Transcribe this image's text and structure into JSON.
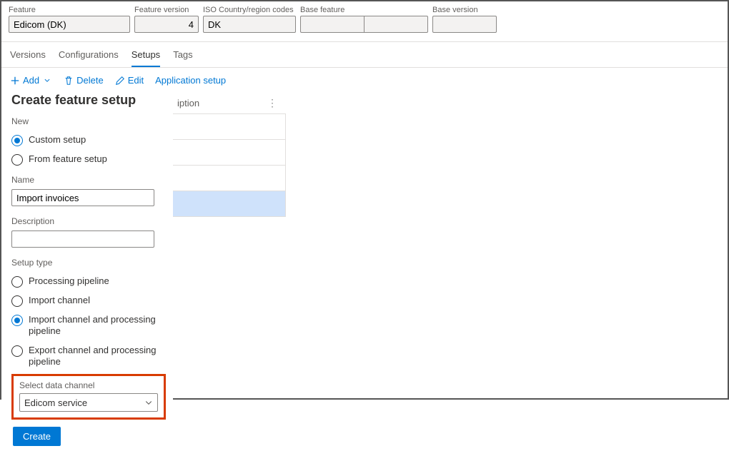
{
  "header": {
    "feature_label": "Feature",
    "feature_value": "Edicom (DK)",
    "version_label": "Feature version",
    "version_value": "4",
    "iso_label": "ISO Country/region codes",
    "iso_value": "DK",
    "basefeat_label": "Base feature",
    "basefeat_value": "",
    "basefeat_value2": "",
    "basever_label": "Base version",
    "basever_value": ""
  },
  "tabs": {
    "versions": "Versions",
    "configurations": "Configurations",
    "setups": "Setups",
    "tags": "Tags"
  },
  "toolbar": {
    "add": "Add",
    "delete": "Delete",
    "edit": "Edit",
    "appsetup": "Application setup"
  },
  "panel": {
    "title": "Create feature setup",
    "new_label": "New",
    "opt_custom": "Custom setup",
    "opt_fromfeature": "From feature setup",
    "name_label": "Name",
    "name_value": "Import invoices",
    "desc_label": "Description",
    "desc_value": "",
    "setuptype_label": "Setup type",
    "st_processing": "Processing pipeline",
    "st_import": "Import channel",
    "st_import_proc": "Import channel and processing pipeline",
    "st_export_proc": "Export channel and processing pipeline",
    "selectdc_label": "Select data channel",
    "selectdc_value": "Edicom service",
    "create_btn": "Create"
  },
  "grid": {
    "col_description": "iption"
  }
}
